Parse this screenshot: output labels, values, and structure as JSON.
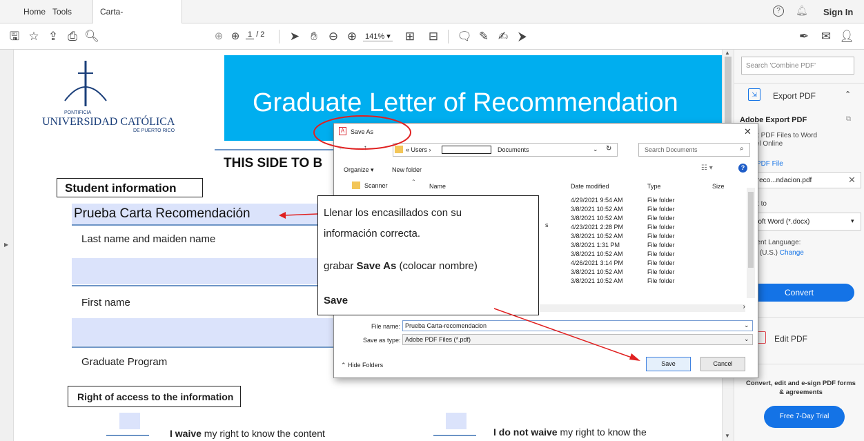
{
  "tabs": {
    "home": "Home",
    "tools": "Tools",
    "doc": "Carta-recomendaci...",
    "close": "×"
  },
  "topright": {
    "signin": "Sign In"
  },
  "toolbar": {
    "page_current": "1",
    "page_total": "/ 2",
    "zoom": "141%"
  },
  "document": {
    "university_top": "PONTIFICIA",
    "university_name": "UNIVERSIDAD CATÓLICA",
    "university_sub": "DE PUERTO RICO",
    "banner_title": "Graduate Letter of Recommendation",
    "side_heading": "THIS SIDE TO B",
    "student_info": "Student information",
    "name_value": "Prueba Carta Recomendación",
    "last_name_label": "Last name and maiden name",
    "first_name_label": "First name",
    "program_label": "Graduate Program",
    "right_access": "Right of access to the information",
    "waive_bold": "I waive",
    "waive_rest": " my right to know the content",
    "notwaive_bold": "I do not waive",
    "notwaive_rest": " my right to know the"
  },
  "callout": {
    "line1": "Llenar los encasillados con su",
    "line2": "información correcta.",
    "line3_pre": "grabar ",
    "line3_bold": "Save As",
    "line3_post": " (colocar nombre)",
    "line4": "Save"
  },
  "dialog": {
    "title": "Save As",
    "path_users": "Users",
    "path_docs": "Documents",
    "search_placeholder": "Search Documents",
    "organize": "Organize ▾",
    "new_folder": "New folder",
    "nav_item": "Scanner",
    "col_name": "Name",
    "col_date": "Date modified",
    "col_type": "Type",
    "col_size": "Size",
    "rows": [
      {
        "date": "4/29/2021 9:54 AM",
        "type": "File folder"
      },
      {
        "date": "3/8/2021 10:52 AM",
        "type": "File folder"
      },
      {
        "date": "3/8/2021 10:52 AM",
        "type": "File folder"
      },
      {
        "date": "4/23/2021 2:28 PM",
        "type": "File folder"
      },
      {
        "date": "3/8/2021 10:52 AM",
        "type": "File folder"
      },
      {
        "date": "3/8/2021 1:31 PM",
        "type": "File folder"
      },
      {
        "date": "3/8/2021 10:52 AM",
        "type": "File folder"
      },
      {
        "date": "4/26/2021 3:14 PM",
        "type": "File folder"
      },
      {
        "date": "3/8/2021 10:52 AM",
        "type": "File folder"
      },
      {
        "date": "3/8/2021 10:52 AM",
        "type": "File folder"
      }
    ],
    "stray_s": "s",
    "filename_label": "File name:",
    "filename_value": "Prueba Carta-recomendacion",
    "savetype_label": "Save as type:",
    "savetype_value": "Adobe PDF Files (*.pdf)",
    "hide_folders": "Hide Folders",
    "save": "Save",
    "cancel": "Cancel"
  },
  "rightpanel": {
    "search_placeholder": "Search 'Combine PDF'",
    "export_pdf": "Export PDF",
    "adobe_export": "Adobe Export PDF",
    "convert_desc1": "onvert PDF Files to Word",
    "convert_desc2": "r Excel Online",
    "select_file": "elect PDF File",
    "file_name": "Carta-reco...ndacion.pdf",
    "convert_to": "onvert to",
    "format": "Microsoft Word (*.docx)",
    "doc_lang": "ocument Language:",
    "lang": "nglish (U.S.)",
    "change": "Change",
    "convert_btn": "Convert",
    "edit_pdf": "Edit PDF",
    "promo": "Convert, edit and e-sign PDF forms & agreements",
    "trial": "Free 7-Day Trial"
  },
  "colors": {
    "banner": "#00aeef",
    "accent_blue": "#1473e6",
    "red": "#e02020",
    "field": "#dbe3fb"
  }
}
